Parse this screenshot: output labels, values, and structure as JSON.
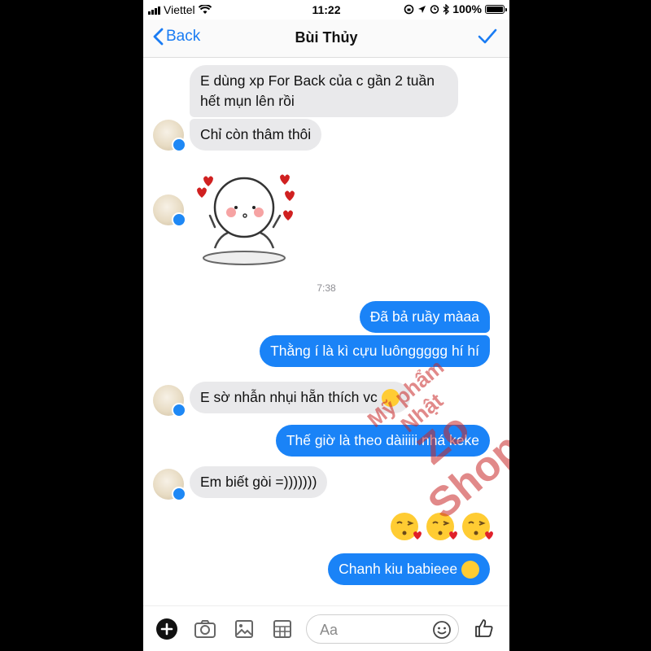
{
  "status": {
    "carrier": "Viettel",
    "time": "11:22",
    "battery": "100%"
  },
  "nav": {
    "back_label": "Back",
    "title": "Bùi Thủy"
  },
  "messages": [
    {
      "text": "E dùng xp For Back của c gần 2 tuần",
      "text2": "hết mụn lên rồi"
    },
    {
      "text": "Chỉ còn thâm thôi"
    },
    {
      "sticker": "cartoon-hearts-sticker"
    },
    {
      "time": "7:38"
    },
    {
      "text": "Đã bả ruầy  màaa"
    },
    {
      "text": "Thằng í là kì cựu luônggggg hí hí"
    },
    {
      "text": "E sờ nhẫn nhụi hẵn thích vc",
      "emoji": "grinning-squint-emoji"
    },
    {
      "text": "Thế giờ là theo dàiiiii nhá keke"
    },
    {
      "text": "Em biết gòi =)))))))"
    },
    {
      "emoji": "kissing-heart-emoji-x3"
    },
    {
      "text": "Chanh kiu babieee",
      "emoji": "kissing-emoji"
    }
  ],
  "watermark": {
    "line1": "Mỹ phẩm Nhật",
    "line2": "Zo Shop"
  },
  "composer": {
    "placeholder": "Aa"
  },
  "colors": {
    "accent": "#1a83f7",
    "incoming": "#e9e9eb",
    "watermark": "#c82828"
  }
}
